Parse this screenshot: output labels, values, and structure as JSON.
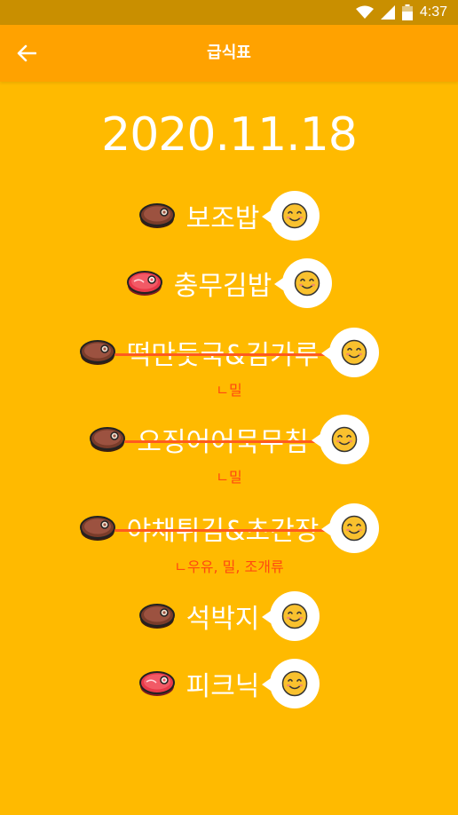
{
  "status_bar": {
    "time": "4:37",
    "icons": [
      "wifi-icon",
      "signal-icon",
      "battery-icon"
    ]
  },
  "app_bar": {
    "title": "급식표",
    "back_icon": "arrow-left-icon"
  },
  "date": "2020.11.18",
  "menu": [
    {
      "name": "보조밥",
      "icon": "meat-icon",
      "struck": false,
      "allergy": ""
    },
    {
      "name": "충무김밥",
      "icon": "raw-meat-icon",
      "struck": false,
      "allergy": ""
    },
    {
      "name": "떡만둣국&김가루",
      "icon": "meat-icon",
      "struck": true,
      "allergy": "ㄴ밀"
    },
    {
      "name": "오징어어묵무침",
      "icon": "meat-icon",
      "struck": true,
      "allergy": "ㄴ밀"
    },
    {
      "name": "야채튀김&초간장",
      "icon": "meat-icon",
      "struck": true,
      "allergy": "ㄴ우유, 밀, 조개류"
    },
    {
      "name": "석박지",
      "icon": "meat-icon",
      "struck": false,
      "allergy": ""
    },
    {
      "name": "피크닉",
      "icon": "raw-meat-icon",
      "struck": false,
      "allergy": ""
    }
  ],
  "colors": {
    "background": "#FFBA00",
    "app_bar": "#FFA200",
    "status_bar": "#C98F00",
    "strike": "#FF5A1F",
    "allergy_text": "#FF4A10"
  }
}
